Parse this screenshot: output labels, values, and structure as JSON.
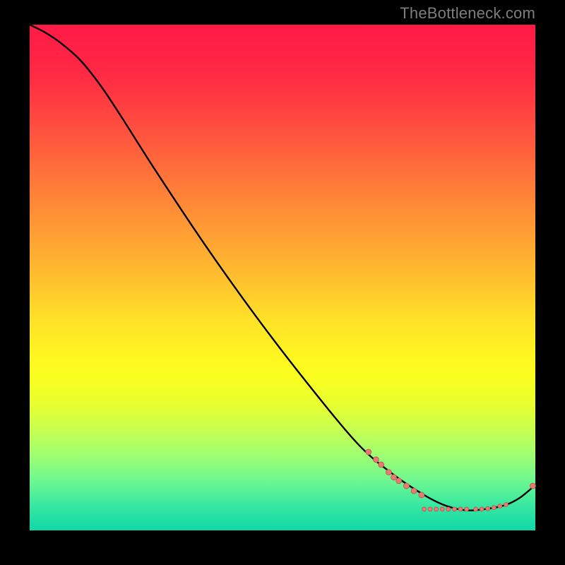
{
  "watermark": "TheBottleneck.com",
  "colors": {
    "curve": "#000000",
    "dot_fill": "#e77a72",
    "dot_stroke": "#b85850"
  },
  "chart_data": {
    "type": "line",
    "title": "",
    "xlabel": "",
    "ylabel": "",
    "xlim": [
      0,
      100
    ],
    "ylim": [
      0,
      100
    ],
    "grid": false,
    "legend": false,
    "notes": "Axes are unlabeled in the figure; values below are estimated in 0–100 normalized units from the visible curve geometry. Y is bottleneck-like (high near 100, dipping to ~4 near x≈86, slight rise at right).",
    "series": [
      {
        "name": "curve",
        "x": [
          0,
          3,
          6,
          10,
          14,
          18,
          25,
          35,
          45,
          55,
          65,
          72,
          78,
          82,
          86,
          90,
          94,
          97,
          100
        ],
        "y": [
          100,
          98.5,
          96.5,
          93,
          88,
          82,
          71,
          56,
          42,
          29,
          17,
          11,
          7,
          5,
          4,
          4.2,
          5,
          6.5,
          9
        ]
      }
    ],
    "dots": {
      "name": "markers",
      "note": "Salmon dots clustered along the curve in the lower-right valley.",
      "points": [
        {
          "x": 67,
          "y": 15.5,
          "r": 4
        },
        {
          "x": 68.5,
          "y": 14,
          "r": 4
        },
        {
          "x": 69.5,
          "y": 13,
          "r": 4
        },
        {
          "x": 71,
          "y": 11.5,
          "r": 4
        },
        {
          "x": 72,
          "y": 10.5,
          "r": 4
        },
        {
          "x": 73,
          "y": 9.8,
          "r": 4
        },
        {
          "x": 74.5,
          "y": 8.8,
          "r": 4
        },
        {
          "x": 76,
          "y": 7.8,
          "r": 4
        },
        {
          "x": 77.5,
          "y": 7,
          "r": 4
        },
        {
          "x": 78,
          "y": 4.2,
          "r": 3
        },
        {
          "x": 79.2,
          "y": 4.2,
          "r": 3
        },
        {
          "x": 80.4,
          "y": 4.2,
          "r": 3
        },
        {
          "x": 81.6,
          "y": 4.2,
          "r": 3
        },
        {
          "x": 82.8,
          "y": 4.2,
          "r": 3
        },
        {
          "x": 84,
          "y": 4.2,
          "r": 3
        },
        {
          "x": 85.2,
          "y": 4.2,
          "r": 3
        },
        {
          "x": 86.4,
          "y": 4.2,
          "r": 3
        },
        {
          "x": 88.2,
          "y": 4.2,
          "r": 3
        },
        {
          "x": 89.4,
          "y": 4.2,
          "r": 3
        },
        {
          "x": 90.6,
          "y": 4.3,
          "r": 3
        },
        {
          "x": 91.8,
          "y": 4.5,
          "r": 3
        },
        {
          "x": 93,
          "y": 4.8,
          "r": 3
        },
        {
          "x": 94.2,
          "y": 5.1,
          "r": 3
        },
        {
          "x": 99.5,
          "y": 8.8,
          "r": 4
        }
      ]
    }
  }
}
